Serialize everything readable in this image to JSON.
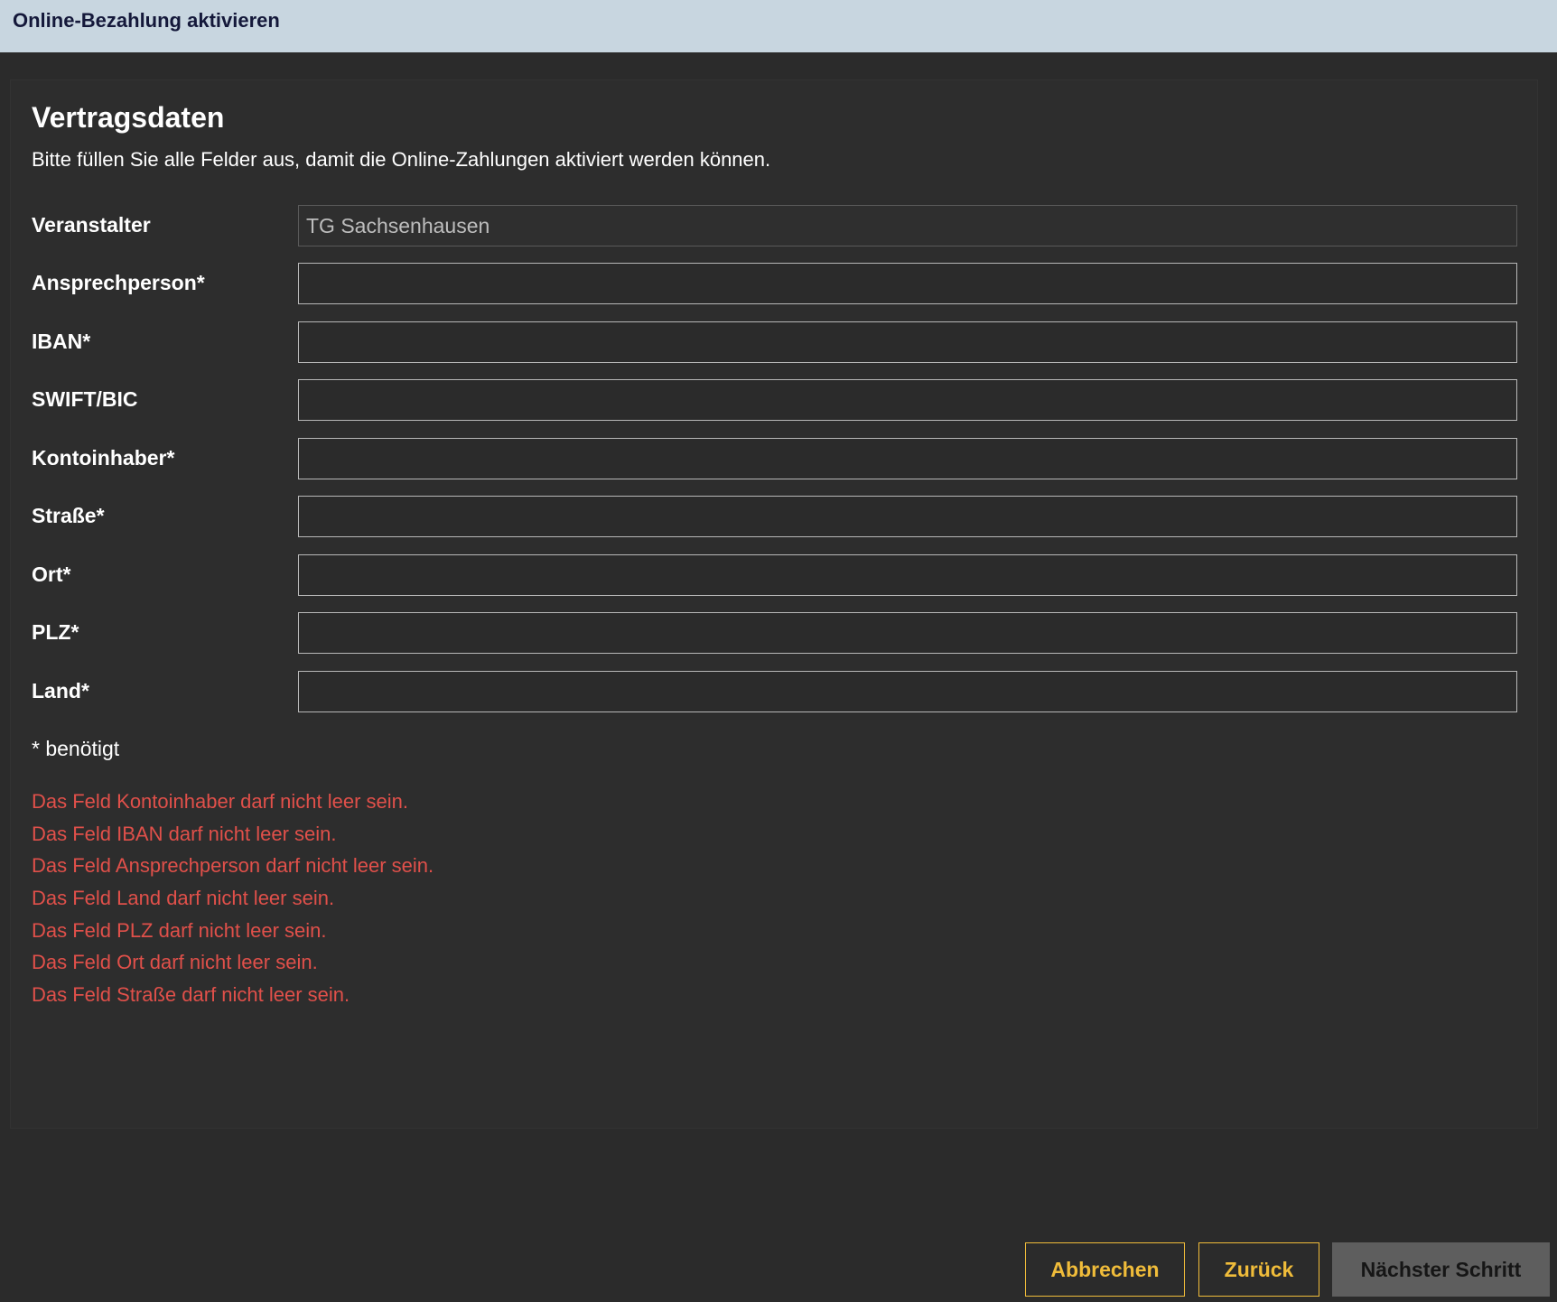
{
  "window": {
    "title": "Online-Bezahlung aktivieren"
  },
  "form": {
    "heading": "Vertragsdaten",
    "intro": "Bitte füllen Sie alle Felder aus, damit die Online-Zahlungen aktiviert werden können.",
    "fields": [
      {
        "label": "Veranstalter",
        "value": "TG Sachsenhausen",
        "readonly": true
      },
      {
        "label": "Ansprechperson*",
        "value": ""
      },
      {
        "label": "IBAN*",
        "value": ""
      },
      {
        "label": "SWIFT/BIC",
        "value": ""
      },
      {
        "label": "Kontoinhaber*",
        "value": ""
      },
      {
        "label": "Straße*",
        "value": ""
      },
      {
        "label": "Ort*",
        "value": ""
      },
      {
        "label": "PLZ*",
        "value": ""
      },
      {
        "label": "Land*",
        "value": ""
      }
    ],
    "required_note": "* benötigt",
    "errors": [
      "Das Feld Kontoinhaber darf nicht leer sein.",
      "Das Feld IBAN darf nicht leer sein.",
      "Das Feld Ansprechperson darf nicht leer sein.",
      "Das Feld Land darf nicht leer sein.",
      "Das Feld PLZ darf nicht leer sein.",
      "Das Feld Ort darf nicht leer sein.",
      "Das Feld Straße darf nicht leer sein."
    ]
  },
  "footer": {
    "cancel_label": "Abbrechen",
    "back_label": "Zurück",
    "next_label": "Nächster Schritt"
  },
  "colors": {
    "titlebar_bg": "#c8d6e0",
    "background": "#2b2b2b",
    "error_text": "#e0504a",
    "accent": "#f0bc3a",
    "primary_button_bg": "#5e5e5e"
  }
}
